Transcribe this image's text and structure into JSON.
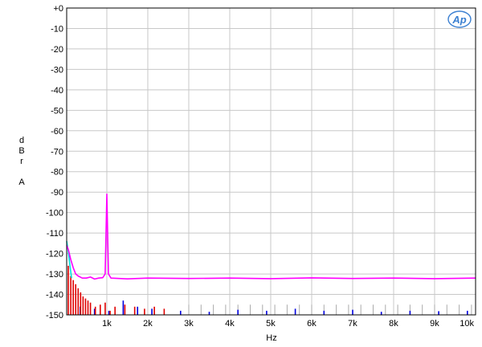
{
  "chart_data": {
    "type": "line",
    "xlabel": "Hz",
    "ylabel_lines": [
      "d",
      "B",
      "r",
      "",
      "A"
    ],
    "xlim": [
      20,
      10000
    ],
    "ylim": [
      -150,
      0
    ],
    "grid": true,
    "x_ticks": [
      {
        "value": 1000,
        "label": "1k"
      },
      {
        "value": 2000,
        "label": "2k"
      },
      {
        "value": 3000,
        "label": "3k"
      },
      {
        "value": 4000,
        "label": "4k"
      },
      {
        "value": 5000,
        "label": "5k"
      },
      {
        "value": 6000,
        "label": "6k"
      },
      {
        "value": 7000,
        "label": "7k"
      },
      {
        "value": 8000,
        "label": "8k"
      },
      {
        "value": 9000,
        "label": "9k"
      },
      {
        "value": 10000,
        "label": "10k"
      }
    ],
    "y_ticks": [
      {
        "value": 0,
        "label": "+0"
      },
      {
        "value": -10,
        "label": "-10"
      },
      {
        "value": -20,
        "label": "-20"
      },
      {
        "value": -30,
        "label": "-30"
      },
      {
        "value": -40,
        "label": "-40"
      },
      {
        "value": -50,
        "label": "-50"
      },
      {
        "value": -60,
        "label": "-60"
      },
      {
        "value": -70,
        "label": "-70"
      },
      {
        "value": -80,
        "label": "-80"
      },
      {
        "value": -90,
        "label": "-90"
      },
      {
        "value": -100,
        "label": "-100"
      },
      {
        "value": -110,
        "label": "-110"
      },
      {
        "value": -120,
        "label": "-120"
      },
      {
        "value": -130,
        "label": "-130"
      },
      {
        "value": -140,
        "label": "-140"
      },
      {
        "value": -150,
        "label": "-150"
      }
    ],
    "series": [
      {
        "color": "#ff00ff",
        "kind": "line",
        "points": [
          [
            20,
            -116
          ],
          [
            60,
            -118
          ],
          [
            120,
            -123
          ],
          [
            180,
            -127
          ],
          [
            240,
            -130
          ],
          [
            300,
            -131
          ],
          [
            400,
            -132
          ],
          [
            500,
            -132
          ],
          [
            600,
            -131.5
          ],
          [
            700,
            -132.5
          ],
          [
            800,
            -132
          ],
          [
            900,
            -131.8
          ],
          [
            960,
            -130
          ],
          [
            1000,
            -91
          ],
          [
            1040,
            -130
          ],
          [
            1100,
            -132
          ],
          [
            1500,
            -132.4
          ],
          [
            2000,
            -132
          ],
          [
            3000,
            -132.2
          ],
          [
            4000,
            -132
          ],
          [
            5000,
            -132.3
          ],
          [
            6000,
            -131.9
          ],
          [
            7000,
            -132.2
          ],
          [
            8000,
            -132
          ],
          [
            9000,
            -132.3
          ],
          [
            10000,
            -132
          ]
        ]
      },
      {
        "color": "#00e0e0",
        "kind": "line",
        "points": [
          [
            20,
            -114
          ],
          [
            60,
            -119
          ],
          [
            100,
            -126
          ],
          [
            140,
            -132
          ]
        ]
      },
      {
        "color": "#e00000",
        "kind": "bars",
        "points": [
          [
            60,
            -126
          ],
          [
            120,
            -131
          ],
          [
            180,
            -133
          ],
          [
            240,
            -135
          ],
          [
            300,
            -137
          ],
          [
            360,
            -139
          ],
          [
            420,
            -141
          ],
          [
            480,
            -142
          ],
          [
            540,
            -143
          ],
          [
            600,
            -144
          ],
          [
            720,
            -146
          ],
          [
            840,
            -145
          ],
          [
            960,
            -144
          ],
          [
            1080,
            -148
          ],
          [
            1200,
            -146
          ],
          [
            1440,
            -145
          ],
          [
            1680,
            -146
          ],
          [
            1920,
            -147
          ],
          [
            2160,
            -146
          ],
          [
            2400,
            -147
          ]
        ]
      },
      {
        "color": "#0000e0",
        "kind": "bars",
        "points": [
          [
            350,
            -146
          ],
          [
            700,
            -147
          ],
          [
            1050,
            -148
          ],
          [
            1400,
            -143
          ],
          [
            1750,
            -146
          ],
          [
            2100,
            -147
          ],
          [
            2800,
            -148
          ],
          [
            3500,
            -148.5
          ],
          [
            4200,
            -147.5
          ],
          [
            4900,
            -148
          ],
          [
            5600,
            -147
          ],
          [
            6300,
            -148
          ],
          [
            7000,
            -147.5
          ],
          [
            7700,
            -148.5
          ],
          [
            8400,
            -148
          ],
          [
            9100,
            -148.2
          ],
          [
            9800,
            -148
          ]
        ]
      },
      {
        "color": "#aaaaaa",
        "kind": "bars",
        "points": [
          [
            3000,
            -145
          ],
          [
            3300,
            -145
          ],
          [
            3600,
            -145
          ],
          [
            3900,
            -145
          ],
          [
            4200,
            -145
          ],
          [
            4500,
            -145
          ],
          [
            4800,
            -145
          ],
          [
            5100,
            -145
          ],
          [
            5400,
            -145
          ],
          [
            5700,
            -145
          ],
          [
            6000,
            -145
          ],
          [
            6300,
            -145
          ],
          [
            6600,
            -145
          ],
          [
            6900,
            -145
          ],
          [
            7200,
            -145
          ],
          [
            7500,
            -145
          ],
          [
            7800,
            -145
          ],
          [
            8100,
            -145
          ],
          [
            8400,
            -145
          ],
          [
            8700,
            -145
          ],
          [
            9000,
            -145
          ],
          [
            9300,
            -145
          ],
          [
            9600,
            -145
          ],
          [
            9900,
            -145
          ]
        ]
      }
    ]
  },
  "logo": {
    "text": "Ap",
    "color": "#3a7fd1"
  }
}
